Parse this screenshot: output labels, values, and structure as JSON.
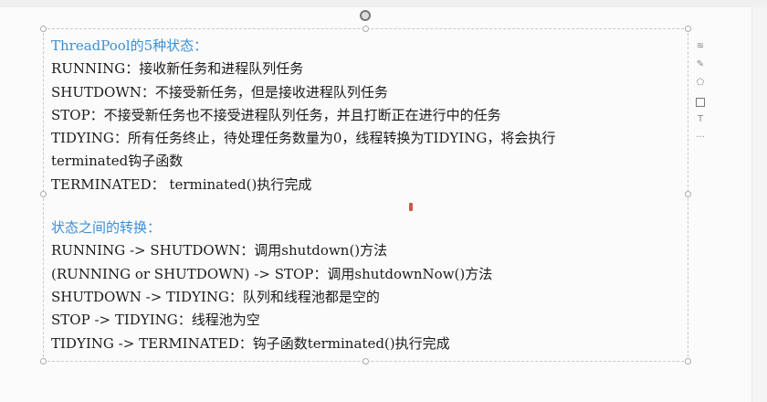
{
  "section1": {
    "heading": "ThreadPool的5种状态：",
    "lines": [
      "RUNNING：接收新任务和进程队列任务",
      "SHUTDOWN：不接受新任务，但是接收进程队列任务",
      "STOP：不接受新任务也不接受进程队列任务，并且打断正在进行中的任务",
      "TIDYING：所有任务终止，待处理任务数量为0，线程转换为TIDYING，将会执行",
      "terminated钩子函数",
      "TERMINATED： terminated()执行完成"
    ]
  },
  "section2": {
    "heading": "状态之间的转换：",
    "lines": [
      "RUNNING -> SHUTDOWN：调用shutdown()方法",
      "(RUNNING or SHUTDOWN) -> STOP：调用shutdownNow()方法",
      "SHUTDOWN -> TIDYING：队列和线程池都是空的",
      "STOP -> TIDYING：线程池为空",
      "TIDYING -> TERMINATED：钩子函数terminated()执行完成"
    ]
  },
  "toolbar": {
    "icons": [
      "layers-icon",
      "pen-icon",
      "shape-icon",
      "crop-icon",
      "text-icon",
      "more-icon"
    ]
  },
  "colors": {
    "heading": "#3a8fd6",
    "text": "#1c1c1c"
  }
}
